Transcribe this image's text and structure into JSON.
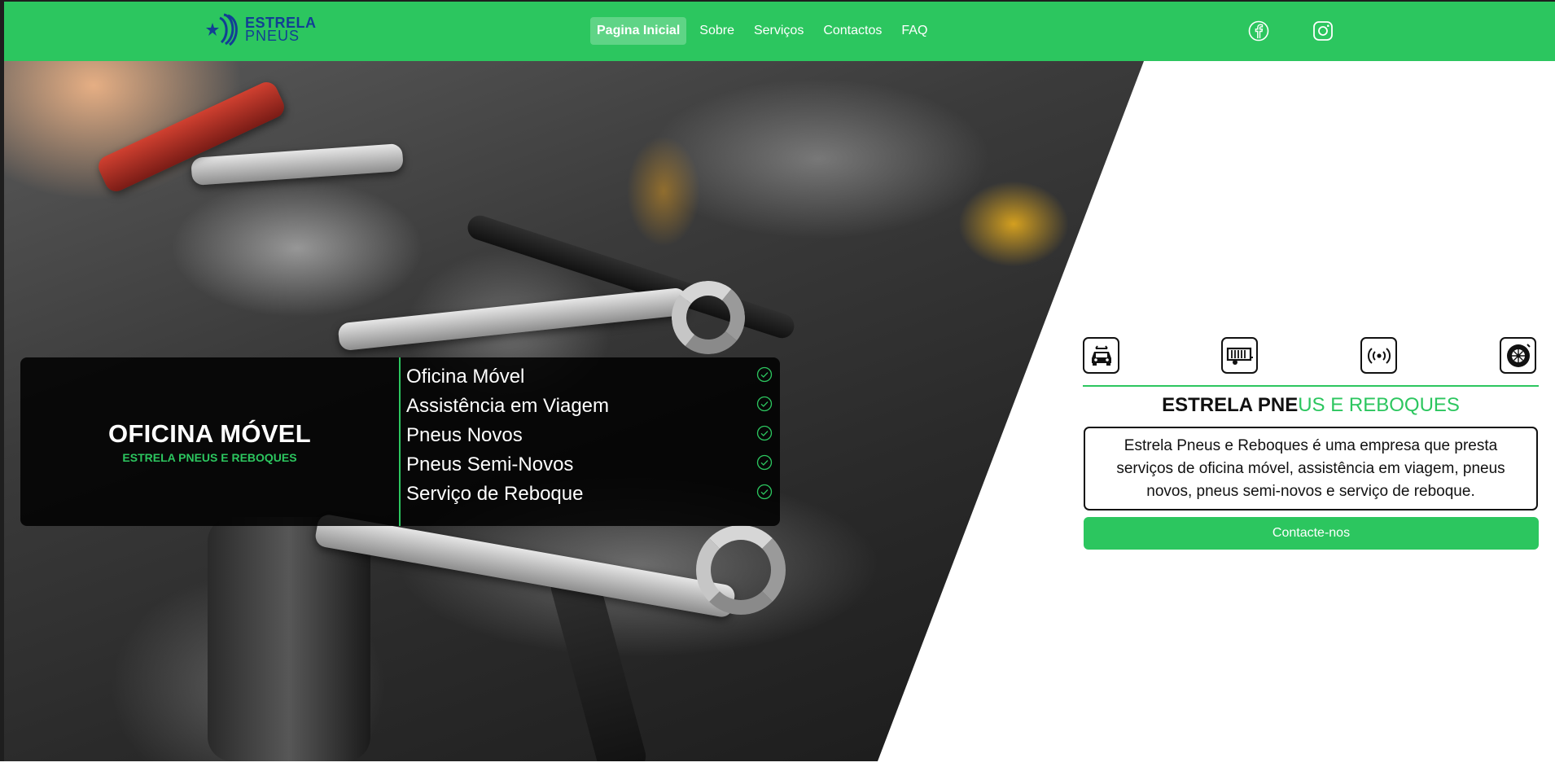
{
  "brand": {
    "line1": "ESTRELA",
    "line2": "PNEUS",
    "logo_color": "#123f94"
  },
  "colors": {
    "accent": "#2cc65f",
    "dark": "#111111"
  },
  "nav": {
    "items": [
      {
        "label": "Pagina Inicial",
        "active": true
      },
      {
        "label": "Sobre"
      },
      {
        "label": "Serviços"
      },
      {
        "label": "Contactos"
      },
      {
        "label": "FAQ"
      }
    ],
    "social": [
      "facebook-icon",
      "instagram-icon"
    ]
  },
  "hero": {
    "title": "OFICINA MÓVEL",
    "subtitle": "ESTRELA PNEUS E REBOQUES",
    "features": [
      "Oficina Móvel",
      "Assistência em Viagem",
      "Pneus Novos",
      "Pneus Semi-Novos",
      "Serviço de Reboque"
    ]
  },
  "about": {
    "service_icons": [
      "car-icon",
      "trailer-icon",
      "signal-icon",
      "tire-icon"
    ],
    "title_dark": "ESTRELA PNE",
    "title_green": "US E REBOQUES",
    "description": "Estrela Pneus e Reboques é uma empresa que presta serviços de oficina móvel, assistência em viagem, pneus novos, pneus semi-novos e serviço de reboque.",
    "cta_label": "Contacte-nos"
  }
}
